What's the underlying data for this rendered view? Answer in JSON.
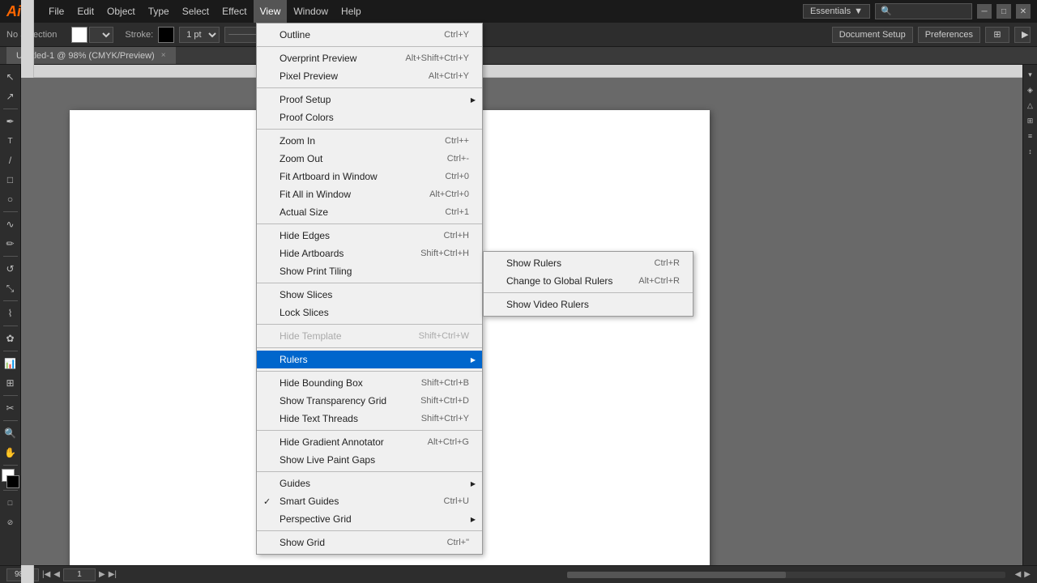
{
  "app": {
    "logo": "Ai",
    "logo_color": "#ff6600"
  },
  "menu_bar": {
    "items": [
      "File",
      "Edit",
      "Object",
      "Type",
      "Select",
      "Effect",
      "View",
      "Window",
      "Help"
    ]
  },
  "options_bar": {
    "no_selection": "No Selection",
    "fill_label": "",
    "stroke_label": "Stroke:",
    "stroke_value": "1 pt",
    "document_setup": "Document Setup",
    "preferences": "Preferences"
  },
  "doc_tab": {
    "title": "Untitled-1 @ 98% (CMYK/Preview)",
    "close": "×"
  },
  "view_menu": {
    "items": [
      {
        "label": "Outline",
        "shortcut": "Ctrl+Y",
        "disabled": false,
        "checked": false,
        "submenu": false
      },
      {
        "separator": true
      },
      {
        "label": "Overprint Preview",
        "shortcut": "Alt+Shift+Ctrl+Y",
        "disabled": false,
        "checked": false,
        "submenu": false
      },
      {
        "label": "Pixel Preview",
        "shortcut": "Alt+Ctrl+Y",
        "disabled": false,
        "checked": false,
        "submenu": false
      },
      {
        "separator": true
      },
      {
        "label": "Proof Setup",
        "shortcut": "",
        "disabled": false,
        "checked": false,
        "submenu": true
      },
      {
        "label": "Proof Colors",
        "shortcut": "",
        "disabled": false,
        "checked": false,
        "submenu": false
      },
      {
        "separator": true
      },
      {
        "label": "Zoom In",
        "shortcut": "Ctrl++",
        "disabled": false,
        "checked": false,
        "submenu": false
      },
      {
        "label": "Zoom Out",
        "shortcut": "Ctrl+-",
        "disabled": false,
        "checked": false,
        "submenu": false
      },
      {
        "label": "Fit Artboard in Window",
        "shortcut": "Ctrl+0",
        "disabled": false,
        "checked": false,
        "submenu": false
      },
      {
        "label": "Fit All in Window",
        "shortcut": "Alt+Ctrl+0",
        "disabled": false,
        "checked": false,
        "submenu": false
      },
      {
        "label": "Actual Size",
        "shortcut": "Ctrl+1",
        "disabled": false,
        "checked": false,
        "submenu": false
      },
      {
        "separator": true
      },
      {
        "label": "Hide Edges",
        "shortcut": "Ctrl+H",
        "disabled": false,
        "checked": false,
        "submenu": false
      },
      {
        "label": "Hide Artboards",
        "shortcut": "Shift+Ctrl+H",
        "disabled": false,
        "checked": false,
        "submenu": false
      },
      {
        "label": "Show Print Tiling",
        "shortcut": "",
        "disabled": false,
        "checked": false,
        "submenu": false
      },
      {
        "separator": true
      },
      {
        "label": "Show Slices",
        "shortcut": "",
        "disabled": false,
        "checked": false,
        "submenu": false
      },
      {
        "label": "Lock Slices",
        "shortcut": "",
        "disabled": false,
        "checked": false,
        "submenu": false
      },
      {
        "separator": true
      },
      {
        "label": "Hide Template",
        "shortcut": "Shift+Ctrl+W",
        "disabled": true,
        "checked": false,
        "submenu": false
      },
      {
        "separator": true
      },
      {
        "label": "Rulers",
        "shortcut": "",
        "disabled": false,
        "checked": false,
        "submenu": true,
        "highlighted": true
      },
      {
        "separator": true
      },
      {
        "label": "Hide Bounding Box",
        "shortcut": "Shift+Ctrl+B",
        "disabled": false,
        "checked": false,
        "submenu": false
      },
      {
        "label": "Show Transparency Grid",
        "shortcut": "Shift+Ctrl+D",
        "disabled": false,
        "checked": false,
        "submenu": false
      },
      {
        "label": "Hide Text Threads",
        "shortcut": "Shift+Ctrl+Y",
        "disabled": false,
        "checked": false,
        "submenu": false
      },
      {
        "separator": true
      },
      {
        "label": "Hide Gradient Annotator",
        "shortcut": "Alt+Ctrl+G",
        "disabled": false,
        "checked": false,
        "submenu": false
      },
      {
        "label": "Show Live Paint Gaps",
        "shortcut": "",
        "disabled": false,
        "checked": false,
        "submenu": false
      },
      {
        "separator": true
      },
      {
        "label": "Guides",
        "shortcut": "",
        "disabled": false,
        "checked": false,
        "submenu": true
      },
      {
        "separator": false
      },
      {
        "label": "Smart Guides",
        "shortcut": "Ctrl+U",
        "disabled": false,
        "checked": true,
        "submenu": false
      },
      {
        "label": "Perspective Grid",
        "shortcut": "",
        "disabled": false,
        "checked": false,
        "submenu": true
      },
      {
        "separator": true
      },
      {
        "label": "Show Grid",
        "shortcut": "Ctrl+\"",
        "disabled": false,
        "checked": false,
        "submenu": false
      }
    ]
  },
  "rulers_submenu": {
    "items": [
      {
        "label": "Show Rulers",
        "shortcut": "Ctrl+R"
      },
      {
        "separator": false
      },
      {
        "label": "Change to Global Rulers",
        "shortcut": "Alt+Ctrl+R"
      },
      {
        "separator": true
      },
      {
        "label": "Show Video Rulers",
        "shortcut": ""
      }
    ]
  },
  "status_bar": {
    "zoom": "98%",
    "page_label": "",
    "page_value": "1"
  },
  "toolbar": {
    "tools": [
      "↖",
      "↔",
      "✏",
      "T",
      "/",
      "□",
      "○",
      "✂",
      "⭮",
      "∿",
      "⊕",
      "🔍",
      "🖐"
    ]
  }
}
